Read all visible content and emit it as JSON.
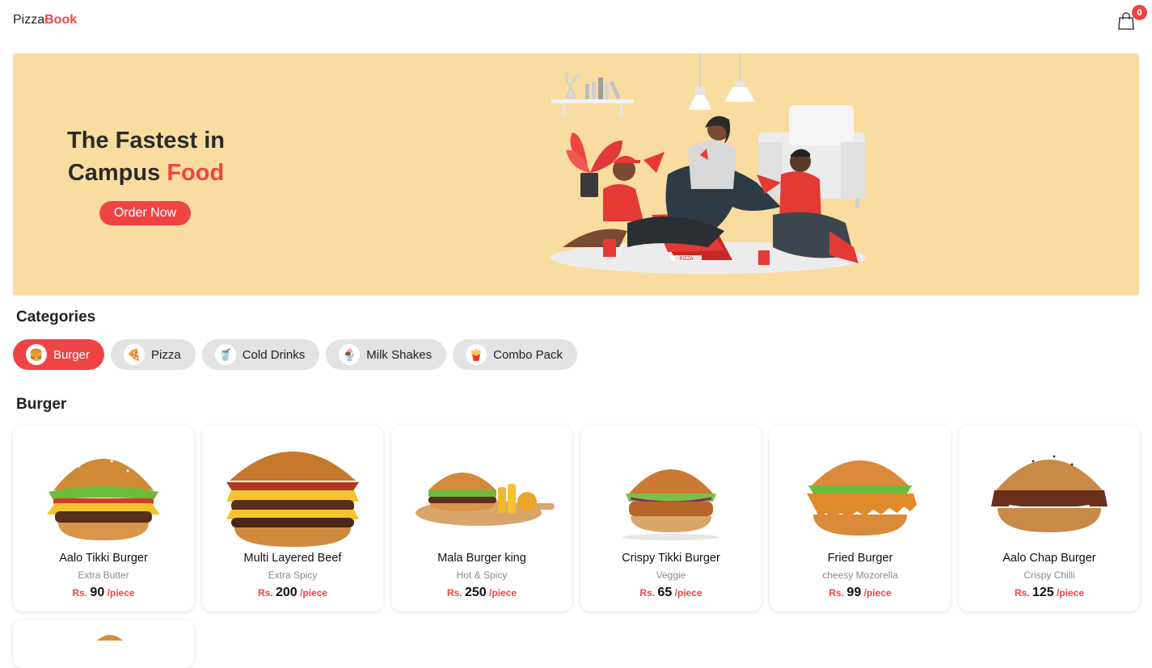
{
  "brand": {
    "part1": "Pizza",
    "part2": "Book"
  },
  "cart": {
    "count": "0"
  },
  "hero": {
    "title_line1": "The Fastest in",
    "title_line2_a": "Campus ",
    "title_line2_b": "Food",
    "cta": "Order Now",
    "box_text": "PIZZA"
  },
  "categories_title": "Categories",
  "categories": [
    {
      "label": "Burger",
      "icon": "burger-icon",
      "glyph": "🍔",
      "active": true
    },
    {
      "label": "Pizza",
      "icon": "pizza-icon",
      "glyph": "🍕",
      "active": false
    },
    {
      "label": "Cold Drinks",
      "icon": "drink-bottle-icon",
      "glyph": "🥤",
      "active": false
    },
    {
      "label": "Milk Shakes",
      "icon": "milkshake-icon",
      "glyph": "🍨",
      "active": false
    },
    {
      "label": "Combo Pack",
      "icon": "combo-pack-icon",
      "glyph": "🍟",
      "active": false
    }
  ],
  "section_title": "Burger",
  "currency": "Rs.",
  "unit": "/piece",
  "products": [
    {
      "name": "Aalo Tikki Burger",
      "desc": "Extra Butter",
      "price": "90"
    },
    {
      "name": "Multi Layered Beef",
      "desc": "Extra Spicy",
      "price": "200"
    },
    {
      "name": "Mala Burger king",
      "desc": "Hot & Spicy",
      "price": "250"
    },
    {
      "name": "Crispy Tikki Burger",
      "desc": "Veggie",
      "price": "65"
    },
    {
      "name": "Fried Burger",
      "desc": "cheesy Mozorella",
      "price": "99"
    },
    {
      "name": "Aalo Chap Burger",
      "desc": "Crispy Chilli",
      "price": "125"
    }
  ],
  "colors": {
    "accent": "#ef4444",
    "hero_bg": "#f9dca0",
    "chip_bg": "#e3e3e3"
  }
}
